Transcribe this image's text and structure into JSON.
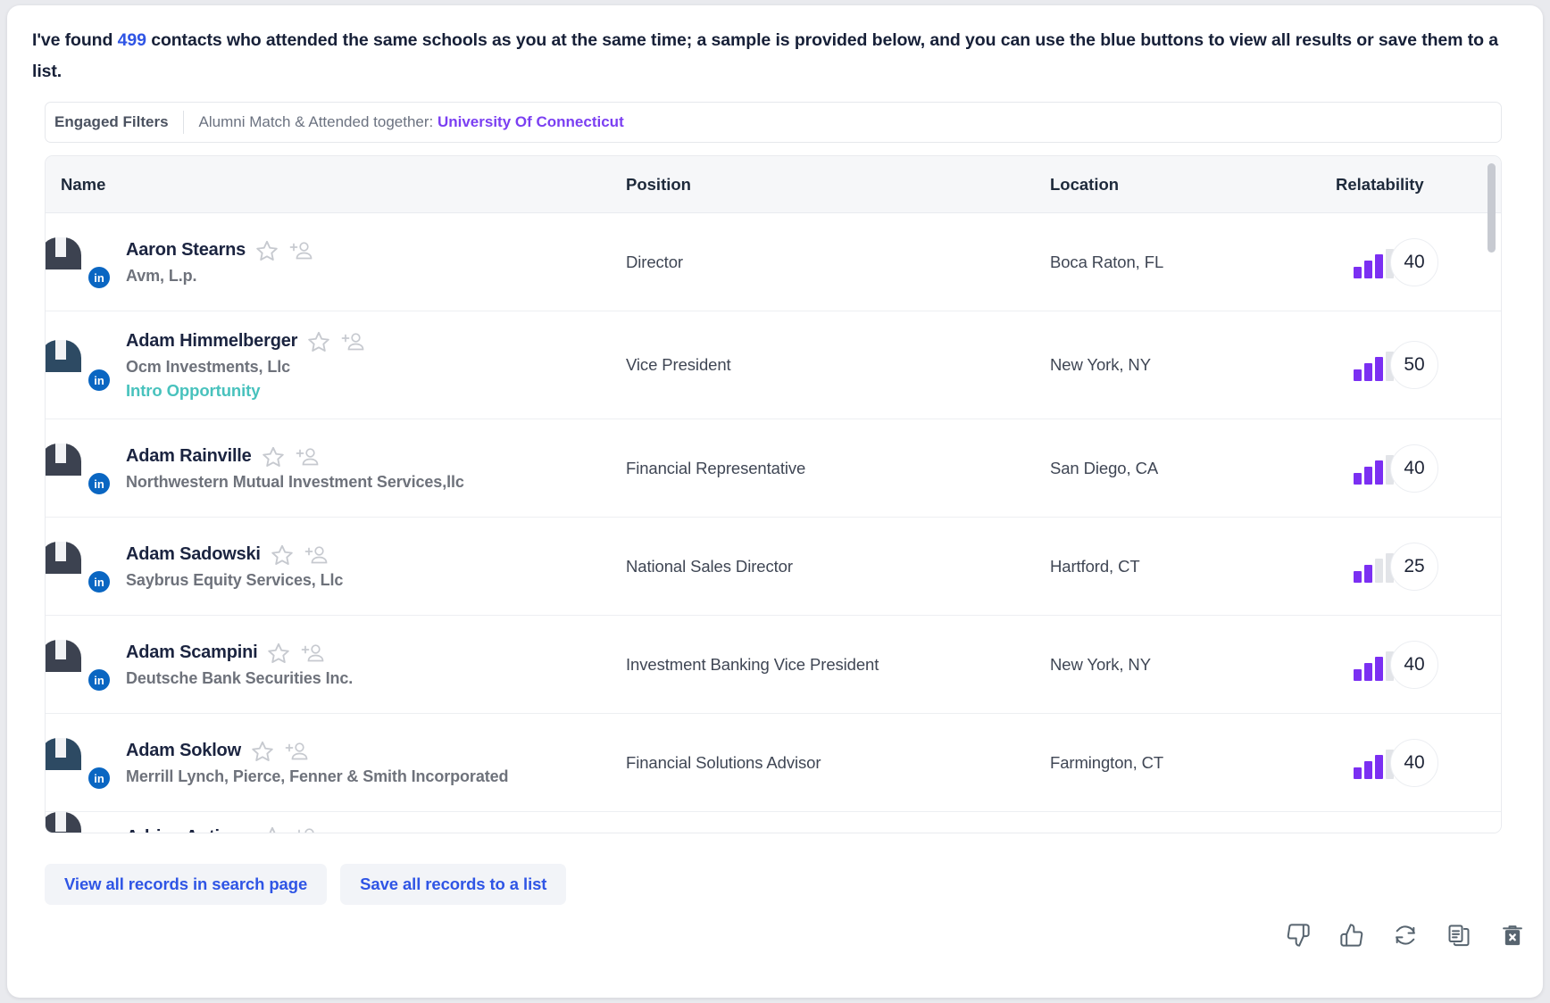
{
  "intro": {
    "prefix": "I've found ",
    "count": "499",
    "suffix": " contacts who attended the same schools as you at the same time; a sample is provided below, and you can use the blue buttons to view all results or save them to a list.",
    "count_color": "#2f55e5"
  },
  "filters": {
    "label": "Engaged Filters",
    "description": "Alumni Match & Attended together: ",
    "school": "University Of Connecticut",
    "school_color": "#7b3ff2"
  },
  "table": {
    "columns": {
      "name": "Name",
      "position": "Position",
      "location": "Location",
      "relatability": "Relatability"
    },
    "rows": [
      {
        "name": "Aaron Stearns",
        "company": "Avm, L.p.",
        "position": "Director",
        "location": "Boca Raton, FL",
        "relatability": "40",
        "filled_bars": 3,
        "badge": "in",
        "tag": ""
      },
      {
        "name": "Adam Himmelberger",
        "company": "Ocm Investments, Llc",
        "position": "Vice President",
        "location": "New York, NY",
        "relatability": "50",
        "filled_bars": 3,
        "badge": "in",
        "tag": "Intro Opportunity"
      },
      {
        "name": "Adam Rainville",
        "company": "Northwestern Mutual Investment Services,llc",
        "position": "Financial Representative",
        "location": "San Diego, CA",
        "relatability": "40",
        "filled_bars": 3,
        "badge": "in",
        "tag": ""
      },
      {
        "name": "Adam Sadowski",
        "company": "Saybrus Equity Services, Llc",
        "position": "National Sales Director",
        "location": "Hartford, CT",
        "relatability": "25",
        "filled_bars": 2,
        "badge": "in",
        "tag": ""
      },
      {
        "name": "Adam Scampini",
        "company": "Deutsche Bank Securities Inc.",
        "position": "Investment Banking Vice President",
        "location": "New York, NY",
        "relatability": "40",
        "filled_bars": 3,
        "badge": "in",
        "tag": ""
      },
      {
        "name": "Adam Soklow",
        "company": "Merrill Lynch, Pierce, Fenner & Smith Incorporated",
        "position": "Financial Solutions Advisor",
        "location": "Farmington, CT",
        "relatability": "40",
        "filled_bars": 3,
        "badge": "in",
        "tag": ""
      }
    ],
    "tag_color": "#48c2bd",
    "bar_on_color": "#7b2ff2",
    "bar_off_color": "#e2e4e8"
  },
  "footer": {
    "view_all_label": "View all records in search page",
    "save_all_label": "Save all records to a list",
    "button_color": "#2f55e5"
  },
  "actions": {
    "thumbs_down": "thumbs-down-icon",
    "thumbs_up": "thumbs-up-icon",
    "refresh": "refresh-icon",
    "copy": "copy-icon",
    "delete": "delete-icon"
  },
  "row_icons": {
    "star": "star-icon",
    "add_person": "add-person-icon"
  }
}
